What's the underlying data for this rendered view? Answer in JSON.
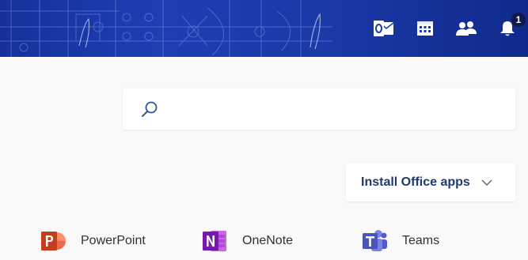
{
  "banner": {
    "notification_count": "1",
    "icons": [
      "outlook-icon",
      "calendar-icon",
      "people-icon",
      "bell-icon"
    ]
  },
  "search": {
    "value": "",
    "placeholder": ""
  },
  "install": {
    "label": "Install Office apps"
  },
  "apps": [
    {
      "name": "PowerPoint",
      "color": "#c43e1c"
    },
    {
      "name": "OneNote",
      "color": "#7719aa"
    },
    {
      "name": "Teams",
      "color": "#4b53bc"
    }
  ],
  "colors": {
    "banner": "#1a3aa8",
    "page_bg": "#f9f9f9",
    "install_text": "#1f3a6b"
  }
}
